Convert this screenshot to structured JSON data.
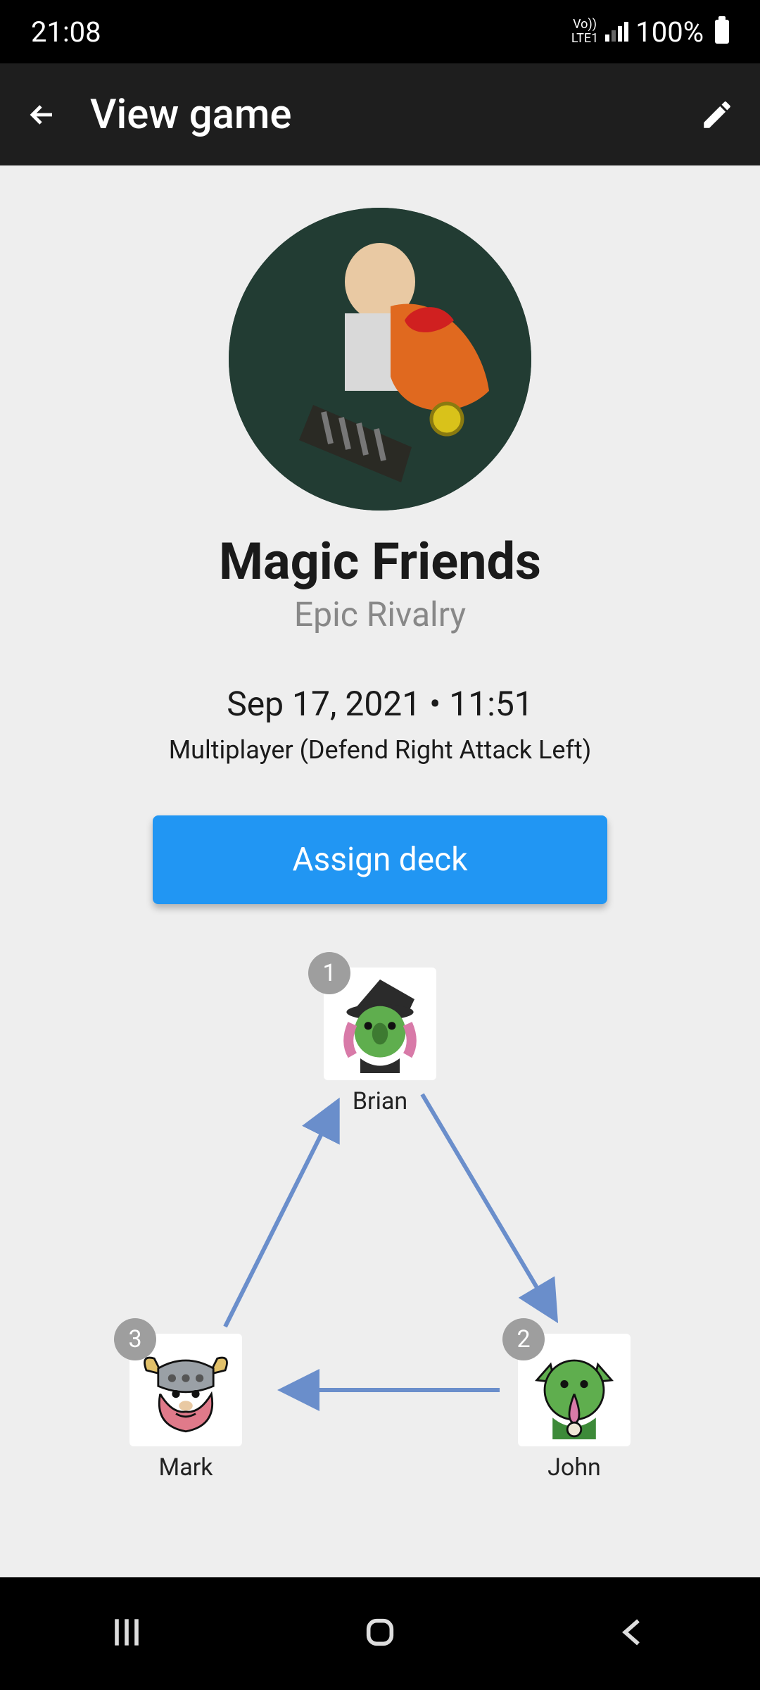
{
  "statusbar": {
    "time": "21:08",
    "battery": "100%",
    "net": "VoLTE1"
  },
  "appbar": {
    "title": "View game"
  },
  "group": {
    "name": "Magic Friends",
    "subtitle": "Epic Rivalry",
    "datetime": "Sep 17, 2021 • 11:51",
    "mode": "Multiplayer (Defend Right Attack Left)"
  },
  "actions": {
    "assign_deck": "Assign deck"
  },
  "players": [
    {
      "order": "1",
      "name": "Brian"
    },
    {
      "order": "2",
      "name": "John"
    },
    {
      "order": "3",
      "name": "Mark"
    }
  ],
  "colors": {
    "accent": "#2196f3",
    "arrow": "#6a8ecb"
  }
}
